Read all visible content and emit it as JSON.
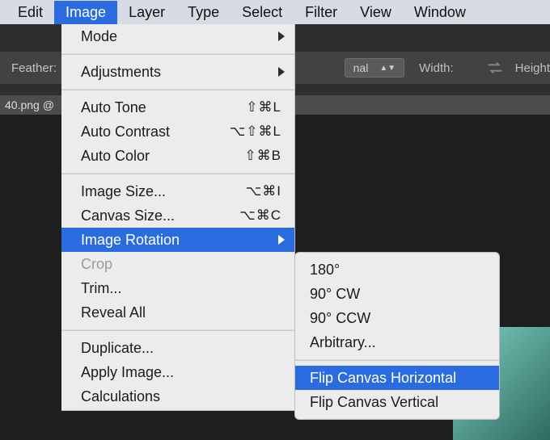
{
  "menubar": {
    "items": [
      {
        "label": "Edit"
      },
      {
        "label": "Image"
      },
      {
        "label": "Layer"
      },
      {
        "label": "Type"
      },
      {
        "label": "Select"
      },
      {
        "label": "Filter"
      },
      {
        "label": "View"
      },
      {
        "label": "Window"
      }
    ],
    "selected_index": 1
  },
  "tool_options": {
    "feather_label": "Feather:",
    "dropdown_value": "nal",
    "width_label": "Width:",
    "height_label": "Height"
  },
  "tab": {
    "title": "40.png @"
  },
  "image_menu": {
    "items": [
      {
        "type": "item",
        "label": "Mode",
        "submenu": true
      },
      {
        "type": "sep"
      },
      {
        "type": "item",
        "label": "Adjustments",
        "submenu": true
      },
      {
        "type": "sep"
      },
      {
        "type": "item",
        "label": "Auto Tone",
        "shortcut": "⇧⌘L"
      },
      {
        "type": "item",
        "label": "Auto Contrast",
        "shortcut": "⌥⇧⌘L"
      },
      {
        "type": "item",
        "label": "Auto Color",
        "shortcut": "⇧⌘B"
      },
      {
        "type": "sep"
      },
      {
        "type": "item",
        "label": "Image Size...",
        "shortcut": "⌥⌘I"
      },
      {
        "type": "item",
        "label": "Canvas Size...",
        "shortcut": "⌥⌘C"
      },
      {
        "type": "item",
        "label": "Image Rotation",
        "submenu": true,
        "highlight": true
      },
      {
        "type": "item",
        "label": "Crop",
        "disabled": true
      },
      {
        "type": "item",
        "label": "Trim..."
      },
      {
        "type": "item",
        "label": "Reveal All"
      },
      {
        "type": "sep"
      },
      {
        "type": "item",
        "label": "Duplicate..."
      },
      {
        "type": "item",
        "label": "Apply Image..."
      },
      {
        "type": "item",
        "label": "Calculations"
      }
    ]
  },
  "rotation_submenu": {
    "items": [
      {
        "type": "item",
        "label": "180°"
      },
      {
        "type": "item",
        "label": "90° CW"
      },
      {
        "type": "item",
        "label": "90° CCW"
      },
      {
        "type": "item",
        "label": "Arbitrary..."
      },
      {
        "type": "sep"
      },
      {
        "type": "item",
        "label": "Flip Canvas Horizontal",
        "highlight": true
      },
      {
        "type": "item",
        "label": "Flip Canvas Vertical"
      }
    ]
  }
}
